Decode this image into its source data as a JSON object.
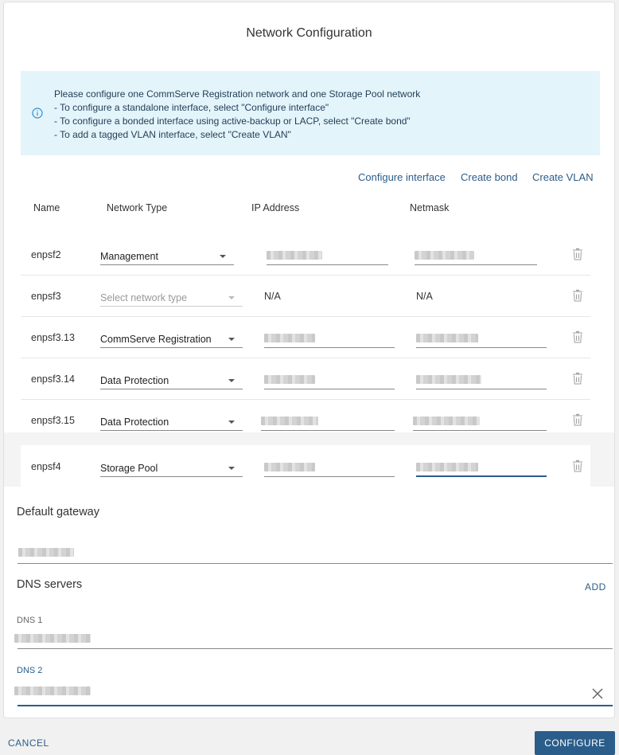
{
  "dialog": {
    "title": "Network Configuration",
    "info_lines": [
      "Please configure one CommServe Registration network and one Storage Pool network",
      "- To configure a standalone interface, select \"Configure interface\"",
      "- To configure a bonded interface using active-backup or LACP, select \"Create bond\"",
      "- To add a tagged VLAN interface, select \"Create VLAN\""
    ],
    "actions": {
      "configure_interface": "Configure interface",
      "create_bond": "Create bond",
      "create_vlan": "Create VLAN"
    },
    "table": {
      "headers": {
        "name": "Name",
        "network_type": "Network Type",
        "ip_address": "IP Address",
        "netmask": "Netmask"
      },
      "rows": [
        {
          "name": "enpsf2",
          "network_type": "Management",
          "ip": "",
          "netmask": ""
        },
        {
          "name": "enpsf3",
          "network_type": "",
          "network_type_placeholder": "Select network type",
          "ip": "N/A",
          "netmask": "N/A"
        },
        {
          "name": "enpsf3.13",
          "network_type": "CommServe Registration",
          "ip": "",
          "netmask": ""
        },
        {
          "name": "enpsf3.14",
          "network_type": "Data Protection",
          "ip": "",
          "netmask": ""
        },
        {
          "name": "enpsf3.15",
          "network_type": "Data Protection",
          "ip": "",
          "netmask": ""
        },
        {
          "name": "enpsf4",
          "network_type": "Storage Pool",
          "ip": "",
          "netmask": ""
        }
      ]
    },
    "gateway": {
      "title": "Default gateway",
      "value": ""
    },
    "dns": {
      "title": "DNS servers",
      "add_label": "ADD",
      "servers": [
        {
          "label": "DNS 1",
          "value": ""
        },
        {
          "label": "DNS 2",
          "value": ""
        }
      ]
    }
  },
  "footer": {
    "cancel_label": "CANCEL",
    "configure_label": "CONFIGURE"
  },
  "colors": {
    "accent": "#2a5d8a",
    "info_bg": "#e4f4fb"
  },
  "icons": {
    "info": "info-circle-icon",
    "delete": "trash-icon",
    "close": "close-icon",
    "dropdown": "caret-down-icon"
  }
}
